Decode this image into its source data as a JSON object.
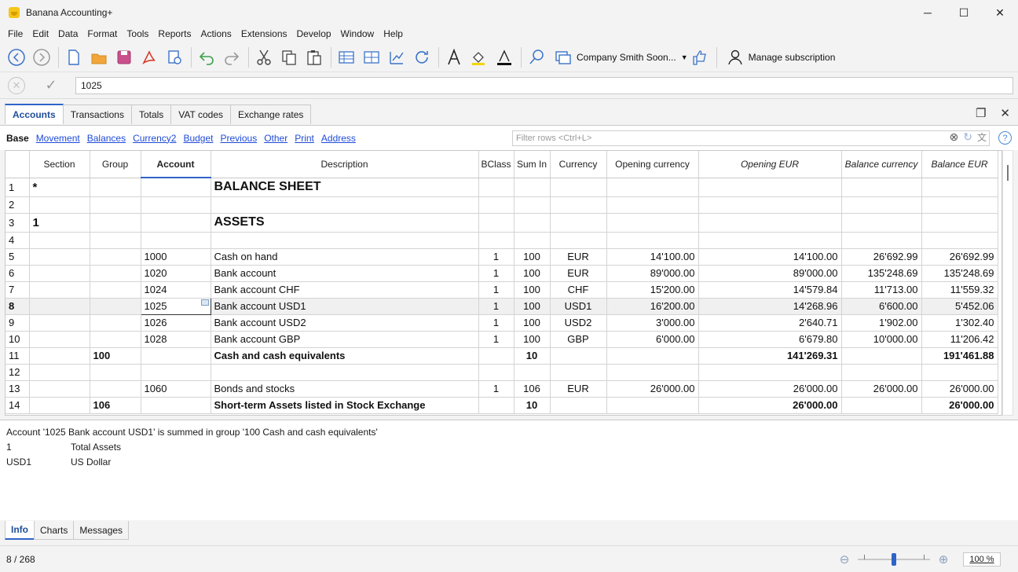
{
  "window": {
    "title": "Banana Accounting+",
    "minimize": "─",
    "maximize": "☐",
    "close": "✕"
  },
  "menu": [
    "File",
    "Edit",
    "Data",
    "Format",
    "Tools",
    "Reports",
    "Actions",
    "Extensions",
    "Develop",
    "Window",
    "Help"
  ],
  "toolbar": {
    "company": "Company Smith  Soon...",
    "manage_subscription": "Manage subscription"
  },
  "editbar": {
    "value": "1025"
  },
  "tabs": [
    "Accounts",
    "Transactions",
    "Totals",
    "VAT codes",
    "Exchange rates"
  ],
  "active_tab": "Accounts",
  "views": [
    "Base",
    "Movement",
    "Balances",
    "Currency2",
    "Budget",
    "Previous",
    "Other",
    "Print",
    "Address"
  ],
  "active_view": "Base",
  "filter": {
    "placeholder": "Filter rows <Ctrl+L>"
  },
  "columns": [
    "Section",
    "Group",
    "Account",
    "Description",
    "BClass",
    "Sum In",
    "Currency",
    "Opening currency",
    "Opening EUR",
    "Balance currency",
    "Balance EUR"
  ],
  "rows": [
    {
      "n": "1",
      "section": "*",
      "group": "",
      "account": "",
      "description": "BALANCE SHEET",
      "bclass": "",
      "sumin": "",
      "currency": "",
      "open_cur": "",
      "open_eur": "",
      "bal_cur": "",
      "bal_eur": ""
    },
    {
      "n": "2",
      "section": "",
      "group": "",
      "account": "",
      "description": "",
      "bclass": "",
      "sumin": "",
      "currency": "",
      "open_cur": "",
      "open_eur": "",
      "bal_cur": "",
      "bal_eur": ""
    },
    {
      "n": "3",
      "section": "1",
      "group": "",
      "account": "",
      "description": "ASSETS",
      "bclass": "",
      "sumin": "",
      "currency": "",
      "open_cur": "",
      "open_eur": "",
      "bal_cur": "",
      "bal_eur": ""
    },
    {
      "n": "4",
      "section": "",
      "group": "",
      "account": "",
      "description": "",
      "bclass": "",
      "sumin": "",
      "currency": "",
      "open_cur": "",
      "open_eur": "",
      "bal_cur": "",
      "bal_eur": ""
    },
    {
      "n": "5",
      "section": "",
      "group": "",
      "account": "1000",
      "description": "Cash on hand",
      "bclass": "1",
      "sumin": "100",
      "currency": "EUR",
      "open_cur": "14'100.00",
      "open_eur": "14'100.00",
      "bal_cur": "26'692.99",
      "bal_eur": "26'692.99"
    },
    {
      "n": "6",
      "section": "",
      "group": "",
      "account": "1020",
      "description": "Bank account",
      "bclass": "1",
      "sumin": "100",
      "currency": "EUR",
      "open_cur": "89'000.00",
      "open_eur": "89'000.00",
      "bal_cur": "135'248.69",
      "bal_eur": "135'248.69"
    },
    {
      "n": "7",
      "section": "",
      "group": "",
      "account": "1024",
      "description": "Bank account CHF",
      "bclass": "1",
      "sumin": "100",
      "currency": "CHF",
      "open_cur": "15'200.00",
      "open_eur": "14'579.84",
      "bal_cur": "11'713.00",
      "bal_eur": "11'559.32"
    },
    {
      "n": "8",
      "section": "",
      "group": "",
      "account": "1025",
      "description": "Bank account USD1",
      "bclass": "1",
      "sumin": "100",
      "currency": "USD1",
      "open_cur": "16'200.00",
      "open_eur": "14'268.96",
      "bal_cur": "6'600.00",
      "bal_eur": "5'452.06"
    },
    {
      "n": "9",
      "section": "",
      "group": "",
      "account": "1026",
      "description": "Bank account USD2",
      "bclass": "1",
      "sumin": "100",
      "currency": "USD2",
      "open_cur": "3'000.00",
      "open_eur": "2'640.71",
      "bal_cur": "1'902.00",
      "bal_eur": "1'302.40"
    },
    {
      "n": "10",
      "section": "",
      "group": "",
      "account": "1028",
      "description": "Bank account GBP",
      "bclass": "1",
      "sumin": "100",
      "currency": "GBP",
      "open_cur": "6'000.00",
      "open_eur": "6'679.80",
      "bal_cur": "10'000.00",
      "bal_eur": "11'206.42"
    },
    {
      "n": "11",
      "section": "",
      "group": "100",
      "account": "",
      "description": "Cash and cash equivalents",
      "bclass": "",
      "sumin": "10",
      "currency": "",
      "open_cur": "",
      "open_eur": "141'269.31",
      "bal_cur": "",
      "bal_eur": "191'461.88"
    },
    {
      "n": "12",
      "section": "",
      "group": "",
      "account": "",
      "description": "",
      "bclass": "",
      "sumin": "",
      "currency": "",
      "open_cur": "",
      "open_eur": "",
      "bal_cur": "",
      "bal_eur": ""
    },
    {
      "n": "13",
      "section": "",
      "group": "",
      "account": "1060",
      "description": "Bonds and stocks",
      "bclass": "1",
      "sumin": "106",
      "currency": "EUR",
      "open_cur": "26'000.00",
      "open_eur": "26'000.00",
      "bal_cur": "26'000.00",
      "bal_eur": "26'000.00"
    },
    {
      "n": "14",
      "section": "",
      "group": "106",
      "account": "",
      "description": "Short-term Assets listed in Stock Exchange",
      "bclass": "",
      "sumin": "10",
      "currency": "",
      "open_cur": "",
      "open_eur": "26'000.00",
      "bal_cur": "",
      "bal_eur": "26'000.00"
    }
  ],
  "info": {
    "message": "Account '1025 Bank account USD1' is summed in group '100 Cash and cash equivalents'",
    "lines": [
      {
        "code": "1",
        "text": "Total Assets"
      },
      {
        "code": "USD1",
        "text": "US Dollar"
      }
    ]
  },
  "bottom_tabs": [
    "Info",
    "Charts",
    "Messages"
  ],
  "status": {
    "position": "8 / 268",
    "zoom": "100 %"
  },
  "colors": {
    "accent": "#2e64c8",
    "link": "#1f4bd8",
    "selected_row": "#f0f0f0"
  }
}
